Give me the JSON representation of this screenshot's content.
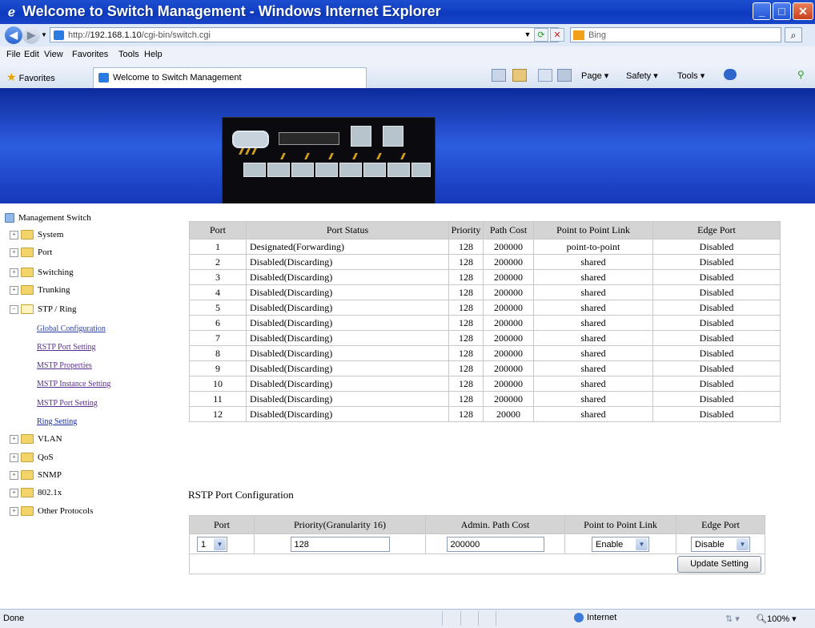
{
  "window": {
    "title": "Welcome to Switch Management - Windows Internet Explorer"
  },
  "address": {
    "url_prefix": "http://",
    "host": "192.168.1.10",
    "path": "/cgi-bin/switch.cgi",
    "search_placeholder": "Bing"
  },
  "menu": [
    "File",
    "Edit",
    "View",
    "Favorites",
    "Tools",
    "Help"
  ],
  "favorites": {
    "label": "Favorites",
    "tab_title": "Welcome to Switch Management"
  },
  "commandbar": {
    "page": "Page ▾",
    "safety": "Safety ▾",
    "tools": "Tools ▾"
  },
  "sidebar": {
    "root": "Management Switch",
    "items": [
      "System",
      "Port",
      "Switching",
      "Trunking",
      "STP / Ring"
    ],
    "stp_subitems": [
      "Global Configuration",
      "RSTP Port Setting",
      "MSTP Properties",
      "MSTP Instance Setting",
      "MSTP Port Setting",
      "Ring Setting"
    ],
    "items_after": [
      "VLAN",
      "QoS",
      "SNMP",
      "802.1x",
      "Other Protocols"
    ]
  },
  "status_table": {
    "headers": [
      "Port",
      "Port Status",
      "Priority",
      "Path Cost",
      "Point to Point Link",
      "Edge Port"
    ],
    "rows": [
      [
        "1",
        "Designated(Forwarding)",
        "128",
        "200000",
        "point-to-point",
        "Disabled"
      ],
      [
        "2",
        "Disabled(Discarding)",
        "128",
        "200000",
        "shared",
        "Disabled"
      ],
      [
        "3",
        "Disabled(Discarding)",
        "128",
        "200000",
        "shared",
        "Disabled"
      ],
      [
        "4",
        "Disabled(Discarding)",
        "128",
        "200000",
        "shared",
        "Disabled"
      ],
      [
        "5",
        "Disabled(Discarding)",
        "128",
        "200000",
        "shared",
        "Disabled"
      ],
      [
        "6",
        "Disabled(Discarding)",
        "128",
        "200000",
        "shared",
        "Disabled"
      ],
      [
        "7",
        "Disabled(Discarding)",
        "128",
        "200000",
        "shared",
        "Disabled"
      ],
      [
        "8",
        "Disabled(Discarding)",
        "128",
        "200000",
        "shared",
        "Disabled"
      ],
      [
        "9",
        "Disabled(Discarding)",
        "128",
        "200000",
        "shared",
        "Disabled"
      ],
      [
        "10",
        "Disabled(Discarding)",
        "128",
        "200000",
        "shared",
        "Disabled"
      ],
      [
        "11",
        "Disabled(Discarding)",
        "128",
        "200000",
        "shared",
        "Disabled"
      ],
      [
        "12",
        "Disabled(Discarding)",
        "128",
        "20000",
        "shared",
        "Disabled"
      ]
    ]
  },
  "config": {
    "title": "RSTP Port Configuration",
    "headers": [
      "Port",
      "Priority(Granularity 16)",
      "Admin. Path Cost",
      "Point to Point Link",
      "Edge Port"
    ],
    "port_value": "1",
    "priority_value": "128",
    "path_cost_value": "200000",
    "p2p_value": "Enable",
    "edge_value": "Disable",
    "update_label": "Update Setting"
  },
  "statusbar": {
    "left": "Done",
    "zone": "Internet",
    "zoom": "100%"
  }
}
